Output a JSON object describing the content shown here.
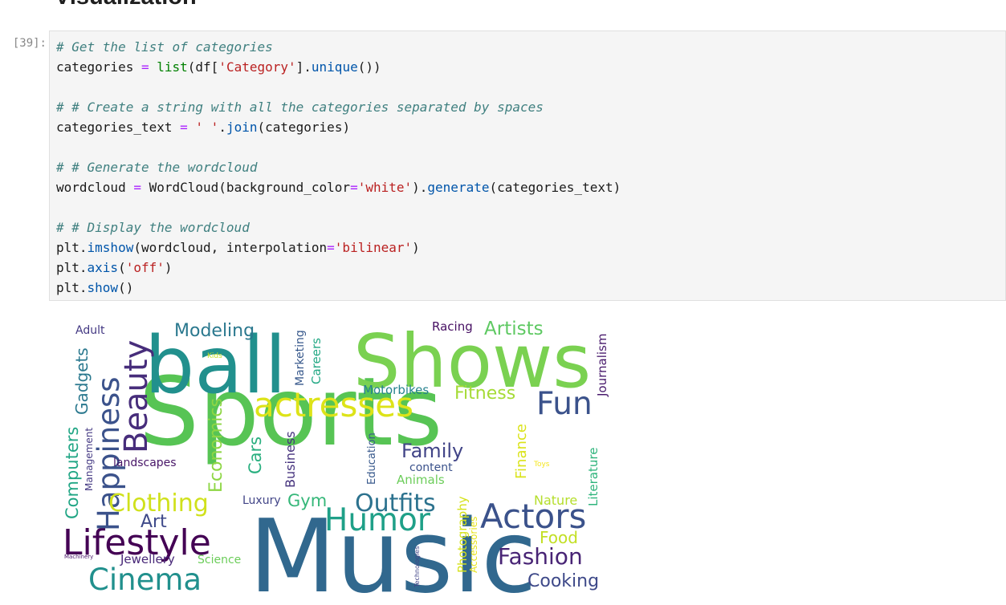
{
  "notebook": {
    "section_heading": "Visualization",
    "cell": {
      "prompt": "[39]:",
      "lines": [
        [
          [
            "cm",
            "# Get the list of categories"
          ]
        ],
        [
          [
            "n",
            "categories "
          ],
          [
            "op",
            "="
          ],
          [
            "n",
            " "
          ],
          [
            "bi",
            "list"
          ],
          [
            "n",
            "(df["
          ],
          [
            "st",
            "'Category'"
          ],
          [
            "n",
            "]."
          ],
          [
            "fn",
            "unique"
          ],
          [
            "n",
            "())"
          ]
        ],
        [],
        [
          [
            "cm",
            "# # Create a string with all the categories separated by spaces"
          ]
        ],
        [
          [
            "n",
            "categories_text "
          ],
          [
            "op",
            "="
          ],
          [
            "n",
            " "
          ],
          [
            "st",
            "' '"
          ],
          [
            "n",
            "."
          ],
          [
            "fn",
            "join"
          ],
          [
            "n",
            "(categories)"
          ]
        ],
        [],
        [
          [
            "cm",
            "# # Generate the wordcloud"
          ]
        ],
        [
          [
            "n",
            "wordcloud "
          ],
          [
            "op",
            "="
          ],
          [
            "n",
            " WordCloud(background_color"
          ],
          [
            "op",
            "="
          ],
          [
            "st",
            "'white'"
          ],
          [
            "n",
            ")."
          ],
          [
            "fn",
            "generate"
          ],
          [
            "n",
            "(categories_text)"
          ]
        ],
        [],
        [
          [
            "cm",
            "# # Display the wordcloud"
          ]
        ],
        [
          [
            "n",
            "plt."
          ],
          [
            "fn",
            "imshow"
          ],
          [
            "n",
            "(wordcloud, interpolation"
          ],
          [
            "op",
            "="
          ],
          [
            "st",
            "'bilinear'"
          ],
          [
            "n",
            ")"
          ]
        ],
        [
          [
            "n",
            "plt."
          ],
          [
            "fn",
            "axis"
          ],
          [
            "n",
            "("
          ],
          [
            "st",
            "'off'"
          ],
          [
            "n",
            ")"
          ]
        ],
        [
          [
            "n",
            "plt."
          ],
          [
            "fn",
            "show"
          ],
          [
            "n",
            "()"
          ]
        ]
      ]
    },
    "wordcloud": {
      "words": [
        {
          "text": "Sports",
          "color": "#57c454"
        },
        {
          "text": "Music",
          "color": "#31688e"
        },
        {
          "text": "ball",
          "color": "#21908d"
        },
        {
          "text": "Shows",
          "color": "#7ad151"
        },
        {
          "text": "actresses",
          "color": "#dde318"
        },
        {
          "text": "Lifestyle",
          "color": "#440154"
        },
        {
          "text": "Happiness",
          "color": "#3b528b"
        },
        {
          "text": "Beauty",
          "color": "#472d7b"
        },
        {
          "text": "Cinema",
          "color": "#21908d"
        },
        {
          "text": "Actors",
          "color": "#3b528b"
        },
        {
          "text": "Humor",
          "color": "#1fa088"
        },
        {
          "text": "Outfits",
          "color": "#2c728e"
        },
        {
          "text": "Fun",
          "color": "#3b528b"
        },
        {
          "text": "Clothing",
          "color": "#d0e11c"
        },
        {
          "text": "Fashion",
          "color": "#482475"
        },
        {
          "text": "Family",
          "color": "#414487"
        },
        {
          "text": "Modeling",
          "color": "#2a788e"
        },
        {
          "text": "Artists",
          "color": "#5ec962"
        },
        {
          "text": "Fitness",
          "color": "#a5db36"
        },
        {
          "text": "Motorbikes",
          "color": "#26828e"
        },
        {
          "text": "Cooking",
          "color": "#3e4989"
        },
        {
          "text": "Food",
          "color": "#c2df23"
        },
        {
          "text": "Nature",
          "color": "#b5de2b"
        },
        {
          "text": "Art",
          "color": "#3e4989"
        },
        {
          "text": "Gym",
          "color": "#35b779"
        },
        {
          "text": "Animals",
          "color": "#6ccd5a"
        },
        {
          "text": "content",
          "color": "#3b528b"
        },
        {
          "text": "Luxury",
          "color": "#414487"
        },
        {
          "text": "Racing",
          "color": "#471063"
        },
        {
          "text": "Jewellery",
          "color": "#482878"
        },
        {
          "text": "Science",
          "color": "#6ccd5a"
        },
        {
          "text": "landscapes",
          "color": "#481668"
        },
        {
          "text": "Adult",
          "color": "#443983"
        },
        {
          "text": "Kids",
          "color": "#c2df23"
        },
        {
          "text": "Computers",
          "color": "#21a685"
        },
        {
          "text": "Gadgets",
          "color": "#2a788e"
        },
        {
          "text": "Management",
          "color": "#443983"
        },
        {
          "text": "Economics",
          "color": "#8ed645"
        },
        {
          "text": "Cars",
          "color": "#29af7f"
        },
        {
          "text": "Business",
          "color": "#46337e"
        },
        {
          "text": "Marketing",
          "color": "#38598c"
        },
        {
          "text": "Careers",
          "color": "#22a884"
        },
        {
          "text": "Education",
          "color": "#38598c"
        },
        {
          "text": "Finance",
          "color": "#dae319"
        },
        {
          "text": "Toys",
          "color": "#f5e61f"
        },
        {
          "text": "Literature",
          "color": "#2fb47c"
        },
        {
          "text": "Journalism",
          "color": "#481a6c"
        },
        {
          "text": "Photography",
          "color": "#d5e21a"
        },
        {
          "text": "Accessories",
          "color": "#e7e419"
        },
        {
          "text": "Technologies",
          "color": "#414487"
        },
        {
          "text": "Machinery",
          "color": "#481668"
        }
      ]
    }
  }
}
